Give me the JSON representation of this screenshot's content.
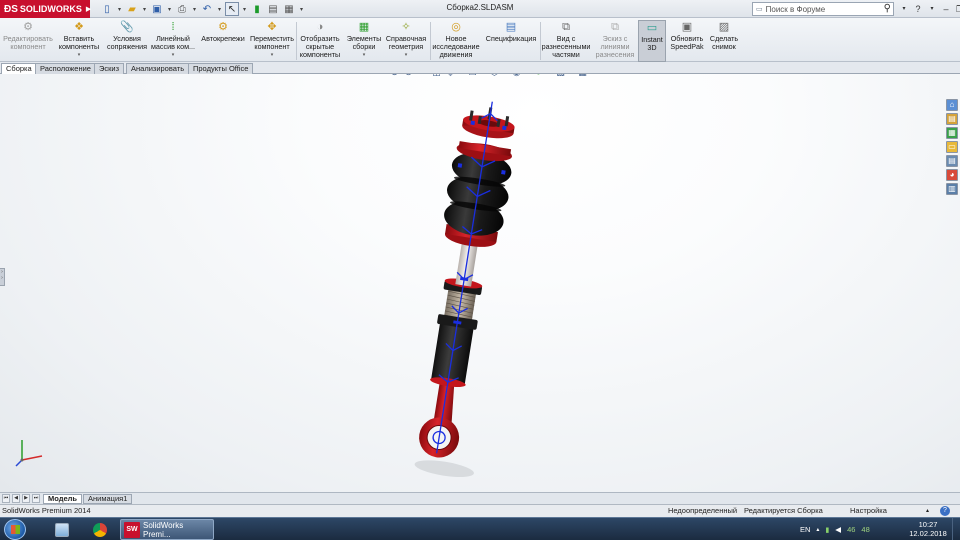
{
  "titlebar": {
    "brand": "SOLIDWORKS",
    "document_title": "Сборка2.SLDASM",
    "search_placeholder": "Поиск в Форуме"
  },
  "commands": [
    {
      "label": "Редактировать компонент",
      "icon": "edit-component-icon",
      "disabled": true
    },
    {
      "label": "Вставить компоненты",
      "icon": "insert-components-icon",
      "dropdown": true
    },
    {
      "label": "Условия сопряжения",
      "icon": "mate-icon"
    },
    {
      "label": "Линейный массив ком...",
      "icon": "linear-pattern-icon",
      "dropdown": true
    },
    {
      "label": "Автокрепежи",
      "icon": "smart-fasteners-icon"
    },
    {
      "label": "Переместить компонент",
      "icon": "move-component-icon",
      "dropdown": true
    },
    {
      "label": "Отобразить скрытые компоненты",
      "icon": "show-hidden-icon"
    },
    {
      "label": "Элементы сборки",
      "icon": "assembly-features-icon",
      "dropdown": true
    },
    {
      "label": "Справочная геометрия",
      "icon": "reference-geometry-icon",
      "dropdown": true
    },
    {
      "label": "Новое исследование движения",
      "icon": "motion-study-icon"
    },
    {
      "label": "Спецификация",
      "icon": "bom-icon"
    },
    {
      "label": "Вид с разнесенными частями",
      "icon": "exploded-view-icon"
    },
    {
      "label": "Эскиз с линиями разнесения",
      "icon": "explode-line-sketch-icon",
      "disabled": true
    },
    {
      "label": "Instant 3D",
      "icon": "instant3d-icon",
      "active": true
    },
    {
      "label": "Обновить SpeedPak",
      "icon": "speedpak-icon"
    },
    {
      "label": "Сделать снимок",
      "icon": "snapshot-icon"
    }
  ],
  "tabs": [
    "Сборка",
    "Расположение",
    "Эскиз",
    "Анализировать",
    "Продукты Office"
  ],
  "active_tab": "Сборка",
  "model_tabs": [
    "Модель",
    "Анимация1"
  ],
  "status": {
    "product": "SolidWorks Premium 2014",
    "definition": "Недоопределенный",
    "editing": "Редактируется Сборка",
    "custom": "Настройка"
  },
  "taskbar": {
    "app_label": "SolidWorks Premi...",
    "lang": "EN",
    "num1": "46",
    "num2": "48",
    "time": "10:27",
    "date": "12.02.2018"
  },
  "colors": {
    "brand_red": "#c8102e",
    "part_red": "#c4161c",
    "part_black": "#1c1c1c",
    "mate_blue": "#1a2ee0"
  }
}
